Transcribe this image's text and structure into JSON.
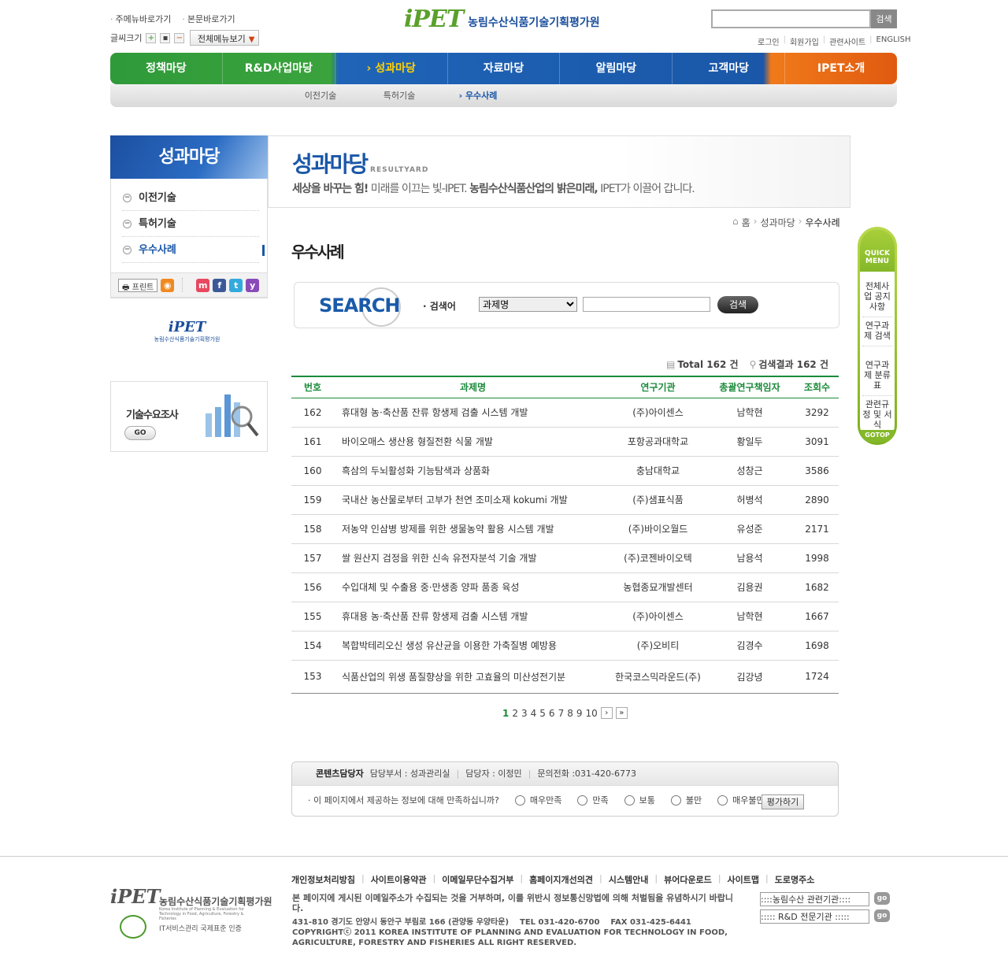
{
  "header": {
    "skip_main_menu": "주메뉴바로가기",
    "skip_content": "본문바로가기",
    "font_size_label": "글씨크기",
    "all_menu": "전체메뉴보기",
    "logo_mark": "iPET",
    "logo_name": "농림수산식품기술기획평가원",
    "search_button": "검색",
    "util": [
      "로그인",
      "회원가입",
      "관련사이트",
      "ENGLISH"
    ]
  },
  "gnb": [
    "정책마당",
    "R&D사업마당",
    "성과마당",
    "자료마당",
    "알림마당",
    "고객마당",
    "IPET소개"
  ],
  "gnb_active": "성과마당",
  "lnb": [
    "이전기술",
    "특허기술",
    "우수사례"
  ],
  "lnb_active": "우수사례",
  "left": {
    "title": "성과마당",
    "menu": [
      "이전기술",
      "특허기술",
      "우수사례"
    ],
    "print": "프린트",
    "logo_mark": "iPET",
    "logo_name": "농림수산식품기술기획평가원",
    "tech_survey": "기술수요조사",
    "go": "GO"
  },
  "content_header": {
    "title": "성과마당",
    "subtitle": "RESULTYARD",
    "slogan_bold1": "세상을 바꾸는 힘!",
    "slogan_1": " 미래를 이끄는 빛-IPET. ",
    "slogan_bold2": "농림수산식품산업의 밝은미래,",
    "slogan_2": " IPET가 이끌어 갑니다."
  },
  "breadcrumb": [
    "홈",
    "성과마당",
    "우수사례"
  ],
  "page_title": "우수사례",
  "search": {
    "big_label": "SEARCH",
    "label": "· 검색어",
    "select_value": "과제명",
    "button": "검색"
  },
  "totals": {
    "total": "Total 162 건",
    "result": "검색결과 162 건"
  },
  "table": {
    "headers": [
      "번호",
      "과제명",
      "연구기관",
      "총괄연구책임자",
      "조회수"
    ],
    "rows": [
      [
        "162",
        "휴대형 농·축산품 잔류 항생제 검출 시스템 개발",
        "(주)아이센스",
        "남학현",
        "3292"
      ],
      [
        "161",
        "바이오매스 생산용 형질전환 식물 개발",
        "포항공과대학교",
        "황일두",
        "3091"
      ],
      [
        "160",
        "흑삼의 두뇌활성화 기능탐색과 상품화",
        "충남대학교",
        "성창근",
        "3586"
      ],
      [
        "159",
        "국내산 농산물로부터 고부가 천연 조미소재 kokumi 개발",
        "(주)샘표식품",
        "허병석",
        "2890"
      ],
      [
        "158",
        "저농약 인삼병 방제를 위한 생물농약 활용 시스템 개발",
        "(주)바이오월드",
        "유성준",
        "2171"
      ],
      [
        "157",
        "쌀 원산지 검정을 위한 신속 유전자분석 기술 개발",
        "(주)코젠바이오텍",
        "남용석",
        "1998"
      ],
      [
        "156",
        "수입대체 및 수출용 중·만생종 양파 품종 육성",
        "농협종묘개발센터",
        "김용권",
        "1682"
      ],
      [
        "155",
        "휴대용 농·축산품 잔류 항생제 검출 시스템 개발",
        "(주)아이센스",
        "남학현",
        "1667"
      ],
      [
        "154",
        "복합박테리오신 생성 유산균을 이용한 가축질병 예방용",
        "(주)오비티",
        "김경수",
        "1698"
      ],
      [
        "153",
        "식품산업의 위생 품질향상을 위한 고효율의 미산성전기분",
        "한국코스믹라운드(주)",
        "김강녕",
        "1724"
      ]
    ]
  },
  "paging": {
    "pages": [
      "1",
      "2",
      "3",
      "4",
      "5",
      "6",
      "7",
      "8",
      "9",
      "10"
    ],
    "current": "1",
    "next": "›",
    "last": "»"
  },
  "eval": {
    "manager_label": "콘텐츠담당자",
    "dept": "담당부서 : 성과관리실",
    "person": "담당자 : 이정민",
    "phone": "문의전화 :031-420-6773",
    "question": "· 이 페이지에서 제공하는 정보에 대해 만족하십니까?",
    "options": [
      "매우만족",
      "만족",
      "보통",
      "불만",
      "매우불만"
    ],
    "button": "평가하기"
  },
  "quick": {
    "title": "QUICK MENU",
    "items": [
      "전체사업 공지사항",
      "연구과제 검색",
      "연구과제 분류표",
      "관련규정 및 서식"
    ],
    "gotop": "GOTOP"
  },
  "footer": {
    "links": [
      "개인정보처리방침",
      "사이트이용약관",
      "이메일무단수집거부",
      "홈페이지개선의견",
      "시스템안내",
      "뷰어다운로드",
      "사이트맵",
      "도로명주소"
    ],
    "logo_mark": "iPET",
    "logo_name": "농림수산식품기술기획평가원",
    "logo_en": "Korea Institute of Planning & Evaluation for Technology in Food, Agriculture, Forestry & Fisheries",
    "cert": "IT서비스관리 국제표준 인증",
    "notice": "본 페이지에 게시된 이메일주소가 수집되는 것을 거부하며, 이를 위반시 정보통신망법에 의해 처벌됨을 유념하시기 바랍니다.",
    "address": "431-810 경기도 안양시 동안구 부림로 166 (관양동 우양타운)",
    "tel": "TEL 031-420-6700",
    "fax": "FAX 031-425-6441",
    "copyright": "COPYRIGHTⓒ 2011 KOREA INSTITUTE OF PLANNING AND EVALUATION FOR TECHNOLOGY IN FOOD, AGRICULTURE, FORESTRY AND FISHERIES ALL RIGHT RESERVED.",
    "select1": "::::농림수산 관련기관::::",
    "select2": "::::: R&D 전문기관 :::::",
    "go": "go"
  }
}
